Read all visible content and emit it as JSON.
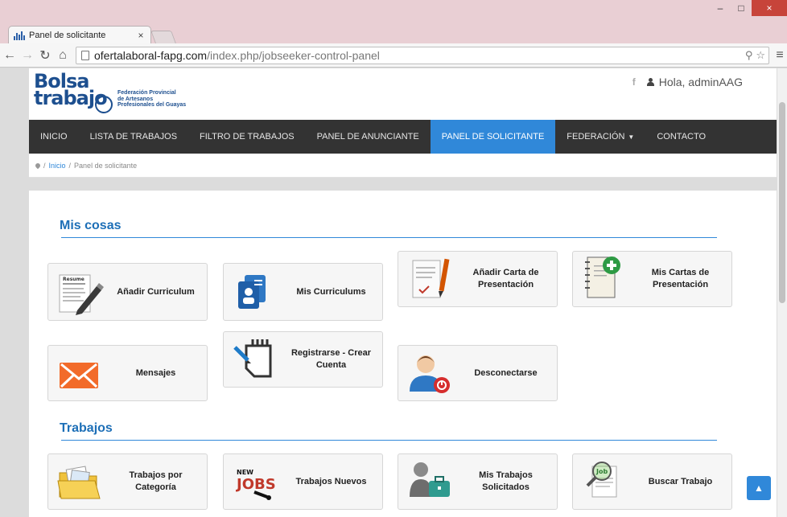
{
  "browser": {
    "tab_title": "Panel de solicitante",
    "tab_close": "×",
    "url_domain": "ofertalaboral-fapg.com",
    "url_path": "/index.php/jobseeker-control-panel",
    "window_min": "–",
    "window_max": "□",
    "window_close": "×"
  },
  "header": {
    "logo_line1": "Bolsa",
    "logo_line2": "trabajo",
    "logo_sub1": "Federación Provincial",
    "logo_sub2": "de Artesanos",
    "logo_sub3": "Profesionales del Guayas",
    "facebook_label": "f",
    "greeting": "Hola, adminAAG"
  },
  "nav": {
    "items": [
      {
        "label": "INICIO"
      },
      {
        "label": "LISTA DE TRABAJOS"
      },
      {
        "label": "FILTRO DE TRABAJOS"
      },
      {
        "label": "PANEL DE ANUNCIANTE"
      },
      {
        "label": "PANEL DE SOLICITANTE"
      },
      {
        "label": "FEDERACIÓN"
      },
      {
        "label": "CONTACTO"
      }
    ],
    "active_index": 4
  },
  "breadcrumb": {
    "separator": "/",
    "home": "Inicio",
    "current": "Panel de solicitante"
  },
  "sections": {
    "mis_cosas": "Mis cosas",
    "trabajos": "Trabajos"
  },
  "cards": {
    "anadir_curriculum": "Añadir Curriculum",
    "mis_curriculums": "Mis Curriculums",
    "anadir_carta": "Añadir Carta de Presentación",
    "mis_cartas": "Mis Cartas de Presentación",
    "mensajes": "Mensajes",
    "registrarse": "Registrarse - Crear Cuenta",
    "desconectarse": "Desconectarse",
    "trabajos_categoria": "Trabajos por Categoría",
    "trabajos_nuevos": "Trabajos Nuevos",
    "mis_trabajos": "Mis Trabajos Solicitados",
    "buscar_trabajo": "Buscar Trabajo"
  },
  "icons": {
    "resume_text": "Resume",
    "new_text": "NEW",
    "jobs_text": "JOBS",
    "job_text": "Job"
  },
  "colors": {
    "accent": "#3088d9",
    "navbar": "#333333",
    "title": "#1d6fb7"
  }
}
